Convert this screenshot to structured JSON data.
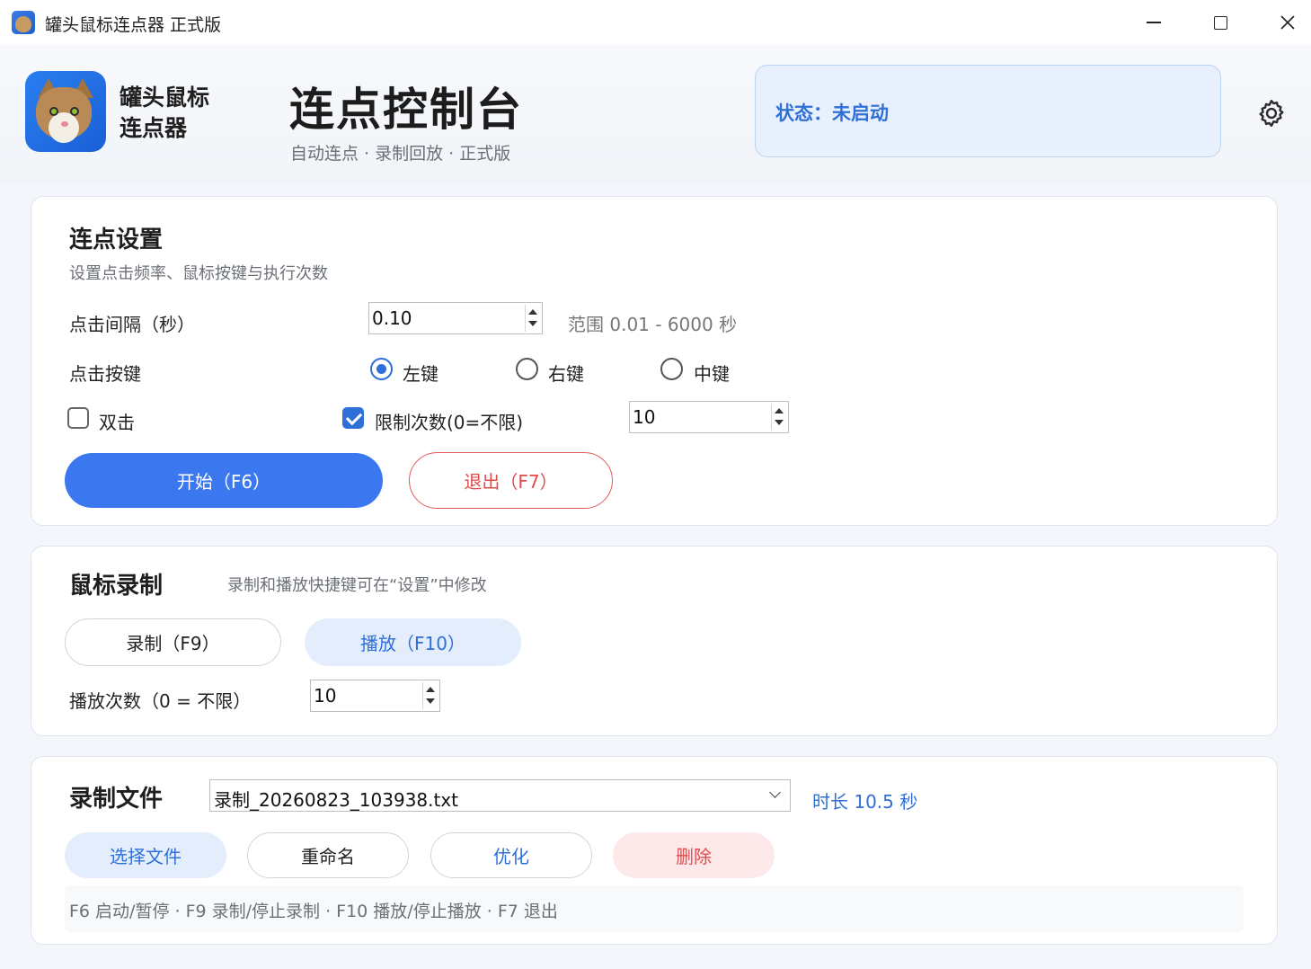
{
  "window": {
    "title": "罐头鼠标连点器 正式版",
    "controls": {
      "minimize": "minimize-icon",
      "maximize": "maximize-icon",
      "close": "close-icon"
    }
  },
  "header": {
    "brand_name": "罐头鼠标\n连点器",
    "title": "连点控制台",
    "subtitle": "自动连点 · 录制回放 · 正式版",
    "status_text": "状态：未启动",
    "settings_icon": "gear-icon"
  },
  "click_settings": {
    "title": "连点设置",
    "description": "设置点击频率、鼠标按键与执行次数",
    "interval_label": "点击间隔（秒）",
    "interval_value": "0.10",
    "interval_range": "范围 0.01 - 6000 秒",
    "button_label": "点击按键",
    "buttons": [
      {
        "label": "左键",
        "checked": true
      },
      {
        "label": "右键",
        "checked": false
      },
      {
        "label": "中键",
        "checked": false
      }
    ],
    "double_click_label": "双击",
    "double_click_checked": false,
    "limit_label": "限制次数(0=不限)",
    "limit_checked": true,
    "limit_value": "10",
    "start_button": "开始（F6）",
    "exit_button": "退出（F7）"
  },
  "mouse_record": {
    "title": "鼠标录制",
    "hint": "录制和播放快捷键可在“设置”中修改",
    "record_button": "录制（F9）",
    "play_button": "播放（F10）",
    "play_count_label": "播放次数（0 = 不限）",
    "play_count_value": "10"
  },
  "record_file": {
    "title": "录制文件",
    "selected_file": "录制_20260823_103938.txt",
    "duration": "时长 10.5 秒",
    "choose_button": "选择文件",
    "rename_button": "重命名",
    "optimize_button": "优化",
    "delete_button": "删除",
    "shortcuts_hint": "F6 启动/暂停 · F9 录制/停止录制 · F10 播放/停止播放 · F7 退出"
  },
  "colors": {
    "accent": "#3b78f0",
    "status_text": "#2f6fd8",
    "danger": "#e24b4b"
  }
}
